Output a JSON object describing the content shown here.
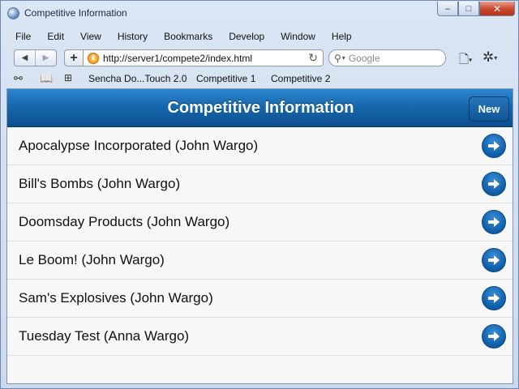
{
  "window": {
    "title": "Competitive Information",
    "minimize_label": "‒",
    "maximize_label": "□",
    "close_label": "✕"
  },
  "menu": {
    "items": [
      "File",
      "Edit",
      "View",
      "History",
      "Bookmarks",
      "Develop",
      "Window",
      "Help"
    ]
  },
  "toolbar": {
    "back_icon": "◀",
    "forward_icon": "▶",
    "add_icon": "+",
    "url": "http://server1/compete2/index.html",
    "reload_icon": "↻",
    "search_placeholder": "Google",
    "page_icon": "🗋",
    "gear_icon": "✲"
  },
  "bookmarks": {
    "items": [
      "Sencha Do...Touch 2.0",
      "Competitive 1",
      "Competitive 2"
    ]
  },
  "app": {
    "title": "Competitive Information",
    "new_button": "New",
    "accent_color": "#1565ab",
    "items": [
      "Apocalypse Incorporated (John Wargo)",
      "Bill's Bombs (John Wargo)",
      "Doomsday Products (John Wargo)",
      "Le Boom! (John Wargo)",
      "Sam's Explosives (John Wargo)",
      "Tuesday Test (Anna Wargo)"
    ]
  }
}
